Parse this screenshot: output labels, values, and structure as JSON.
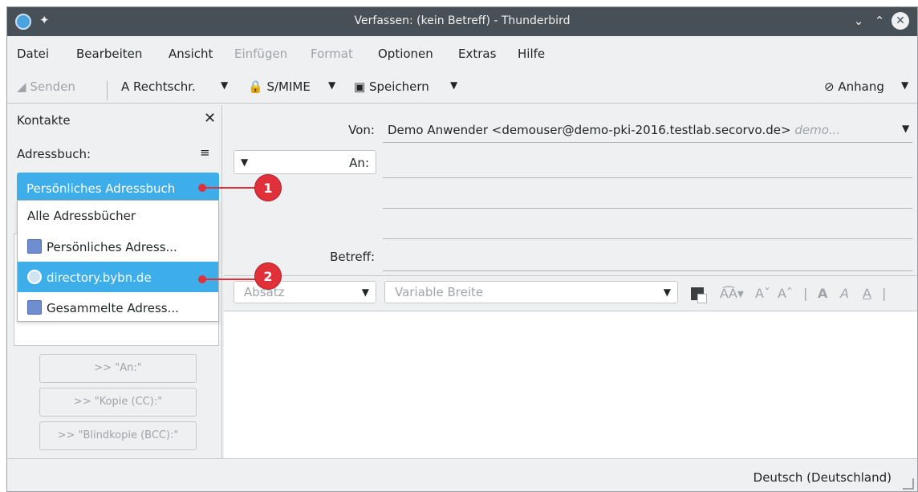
{
  "window": {
    "title": "Verfassen: (kein Betreff) - Thunderbird"
  },
  "menu": [
    "Datei",
    "Bearbeiten",
    "Ansicht",
    "Einfügen",
    "Format",
    "Optionen",
    "Extras",
    "Hilfe"
  ],
  "toolbar": {
    "send": "Senden",
    "spell": "Rechtschr.",
    "smime": "S/MIME",
    "save": "Speichern",
    "attach": "Anhang"
  },
  "sidebar": {
    "title": "Kontakte",
    "addressbook_label": "Adressbuch:",
    "selected": "Persönliches Adressbuch",
    "dropdown": [
      {
        "label": "Alle Adressbücher",
        "icon": "none"
      },
      {
        "label": "Persönliches Adress...",
        "icon": "addressbook-icon"
      },
      {
        "label": "directory.bybn.de",
        "icon": "ldap-directory-icon"
      },
      {
        "label": "Gesammelte Adress...",
        "icon": "addressbook-icon"
      }
    ],
    "buttons": [
      ">> \"An:\"",
      ">> \"Kopie (CC):\"",
      ">> \"Blindkopie (BCC):\""
    ]
  },
  "compose": {
    "from_label": "Von:",
    "from_value": "Demo Anwender <demouser@demo-pki-2016.testlab.secorvo.de>",
    "from_placeholder": "demo...",
    "to_label": "An:",
    "subject_label": "Betreff:",
    "paragraph_format": "Absatz",
    "font": "Variable Breite"
  },
  "status": {
    "language": "Deutsch (Deutschland)"
  },
  "callouts": [
    "1",
    "2"
  ],
  "colors": {
    "titlebar": "#475057",
    "selection": "#3daee9",
    "callout": "#e0303a"
  }
}
